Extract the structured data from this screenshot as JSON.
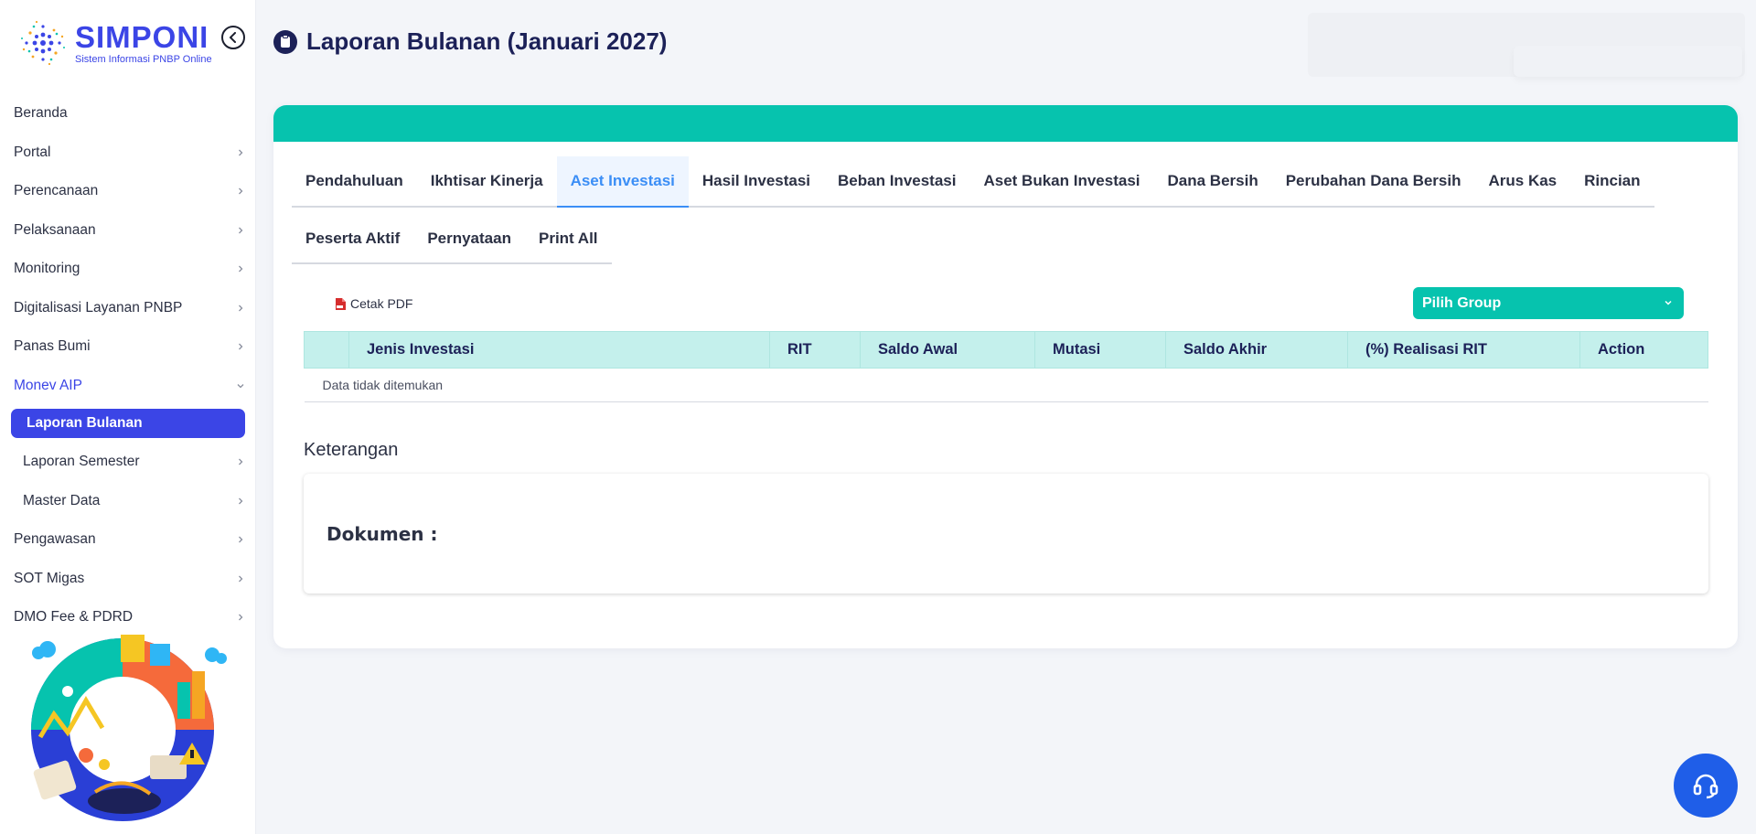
{
  "brand": {
    "name": "SIMPONI",
    "subtitle": "Sistem Informasi PNBP Online"
  },
  "sidebar": {
    "items": [
      {
        "label": "Beranda"
      },
      {
        "label": "Portal"
      },
      {
        "label": "Perencanaan"
      },
      {
        "label": "Pelaksanaan"
      },
      {
        "label": "Monitoring"
      },
      {
        "label": "Digitalisasi Layanan PNBP"
      },
      {
        "label": "Panas Bumi"
      },
      {
        "label": "Monev AIP"
      },
      {
        "label": "Laporan Bulanan"
      },
      {
        "label": "Laporan Semester"
      },
      {
        "label": "Master Data"
      },
      {
        "label": "Pengawasan"
      },
      {
        "label": "SOT Migas"
      },
      {
        "label": "DMO Fee & PDRD"
      }
    ]
  },
  "header": {
    "title": "Laporan Bulanan (Januari 2027)"
  },
  "tabs": {
    "row1": [
      "Pendahuluan",
      "Ikhtisar Kinerja",
      "Aset Investasi",
      "Hasil Investasi",
      "Beban Investasi",
      "Aset Bukan Investasi",
      "Dana Bersih",
      "Perubahan Dana Bersih",
      "Arus Kas",
      "Rincian"
    ],
    "row2": [
      "Peserta Aktif",
      "Pernyataan",
      "Print All"
    ],
    "active": "Aset Investasi"
  },
  "toolbar": {
    "pdf_label": "Cetak PDF",
    "group_placeholder": "Pilih Group"
  },
  "table": {
    "headers": [
      "",
      "Jenis Investasi",
      "RIT",
      "Saldo Awal",
      "Mutasi",
      "Saldo Akhir",
      "(%) Realisasi RIT",
      "Action"
    ],
    "empty_text": "Data tidak ditemukan"
  },
  "keterangan": {
    "title": "Keterangan",
    "dokumen_label": "Dokumen :"
  },
  "colors": {
    "primary": "#3b45e6",
    "teal": "#06c3ae",
    "tab_active": "#3b8ef6",
    "header_bg": "#c4f0ec"
  }
}
